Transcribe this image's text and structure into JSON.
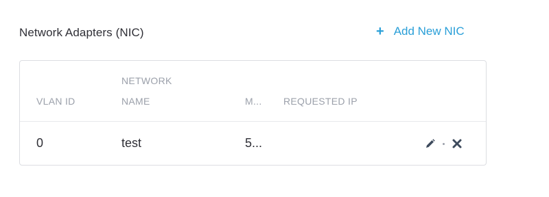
{
  "section": {
    "title": "Network Adapters (NIC)",
    "add_label": "Add New NIC",
    "add_icon": "plus-icon"
  },
  "table": {
    "headers": {
      "vlan_id": "VLAN ID",
      "network_name_line1": "NETWORK",
      "network_name_line2": "NAME",
      "m": "M...",
      "requested_ip": "REQUESTED IP"
    },
    "rows": [
      {
        "vlan_id": "0",
        "network_name": "test",
        "m": "5...",
        "requested_ip": "",
        "actions": [
          "edit-icon",
          "delete-icon"
        ]
      }
    ]
  },
  "colors": {
    "accent": "#2a9fd8",
    "header_text": "#9ba0aa",
    "body_text": "#2f2f36",
    "border": "#dcdde2",
    "icon": "#3d4a5c"
  }
}
